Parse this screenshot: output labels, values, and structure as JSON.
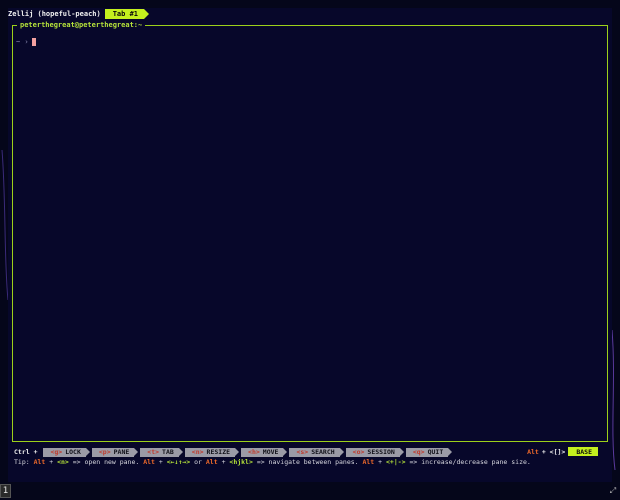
{
  "window": {
    "session_title": "Zellij (hopeful-peach)",
    "active_tab": "Tab #1"
  },
  "pane": {
    "title": "peterthegreat@peterthegreat:~",
    "prompt_symbol": "~ ›"
  },
  "statusbar": {
    "modifier": "Ctrl +",
    "keys": [
      {
        "key": "<g>",
        "label": "LOCK"
      },
      {
        "key": "<p>",
        "label": "PANE"
      },
      {
        "key": "<t>",
        "label": "TAB"
      },
      {
        "key": "<n>",
        "label": "RESIZE"
      },
      {
        "key": "<h>",
        "label": "MOVE"
      },
      {
        "key": "<s>",
        "label": "SEARCH"
      },
      {
        "key": "<o>",
        "label": "SESSION"
      },
      {
        "key": "<q>",
        "label": "QUIT"
      }
    ],
    "right_alt": "Alt",
    "right_plus": "+ <[]>",
    "mode": "BASE"
  },
  "tip": {
    "prefix": "Tip:",
    "alt1": "Alt",
    "plus1": "+",
    "key1": "<n>",
    "text1": "=> open new pane.",
    "alt2": "Alt",
    "plus2": "+",
    "key2": "<←↓↑→>",
    "or": "or",
    "alt3": "Alt",
    "plus3": "+",
    "key3": "<hjkl>",
    "text2": "=> navigate between panes.",
    "alt4": "Alt",
    "plus4": "+",
    "key4": "<+|->",
    "text3": "=> increase/decrease pane size."
  },
  "taskbar": {
    "workspace_number": "1"
  },
  "colors": {
    "background": "#05061a",
    "pane_border": "#9cd01a",
    "accent": "#c4f01e",
    "key_highlight": "#c0392b",
    "alt_orange": "#f06a2a"
  }
}
